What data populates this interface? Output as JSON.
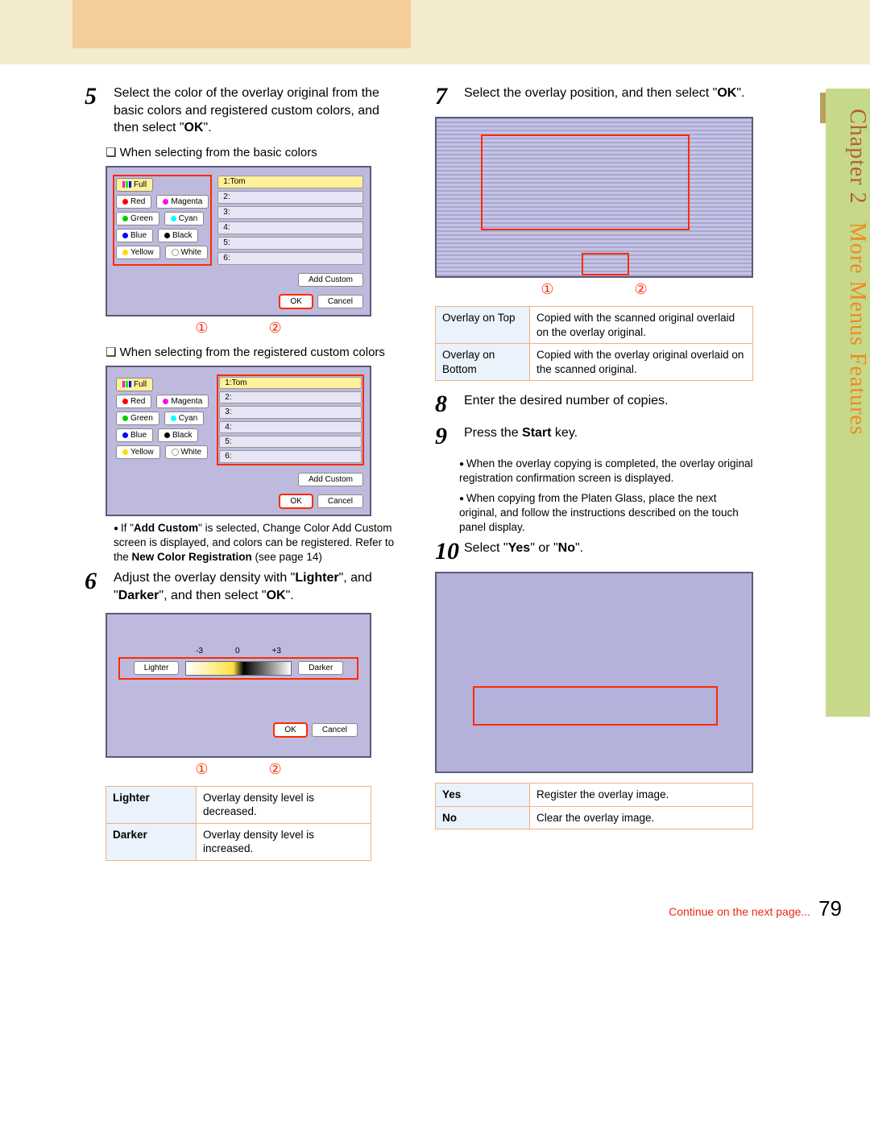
{
  "sidebar": {
    "chapter": "Chapter 2",
    "title": "More Menus Features"
  },
  "steps": {
    "s5": {
      "num": "5",
      "text": "Select the color of the overlay original from the basic colors and registered custom colors, and then select \"",
      "ok": "OK",
      "text2": "\".",
      "sub1": "When selecting from the basic colors",
      "sub2": "When selecting from the registered custom colors",
      "note1a": "If \"",
      "note1b": "Add Custom",
      "note1c": "\" is selected, Change Color Add Custom screen is displayed, and colors can be registered. Refer to the ",
      "note1d": "New Color Registration",
      "note1e": " (see page 14)"
    },
    "s6": {
      "num": "6",
      "text1": "Adjust the overlay density with \"",
      "b1": "Lighter",
      "text2": "\", and \"",
      "b2": "Darker",
      "text3": "\", and then select \"",
      "b3": "OK",
      "text4": "\"."
    },
    "s7": {
      "num": "7",
      "text1": "Select the overlay position, and then select \"",
      "b1": "OK",
      "text2": "\"."
    },
    "s8": {
      "num": "8",
      "text": "Enter the desired number of copies."
    },
    "s9": {
      "num": "9",
      "text1": "Press the ",
      "b1": "Start",
      "text2": " key.",
      "bullet1": "When the overlay copying is completed, the overlay original registration confirmation screen is displayed.",
      "bullet2": "When copying from the Platen Glass, place the next original, and follow the instructions described on the touch panel display."
    },
    "s10": {
      "num": "10",
      "text1": "Select \"",
      "b1": "Yes",
      "text2": "\" or \"",
      "b2": "No",
      "text3": "\"."
    }
  },
  "panel": {
    "full": "Full",
    "red": "Red",
    "magenta": "Magenta",
    "green": "Green",
    "cyan": "Cyan",
    "blue": "Blue",
    "black": "Black",
    "yellow": "Yellow",
    "white": "White",
    "slot1": "1:Tom",
    "slot2": "2:",
    "slot3": "3:",
    "slot4": "4:",
    "slot5": "5:",
    "slot6": "6:",
    "add_custom": "Add Custom",
    "ok": "OK",
    "cancel": "Cancel"
  },
  "density": {
    "m3": "-3",
    "zero": "0",
    "p3": "+3",
    "lighter": "Lighter",
    "darker": "Darker",
    "ok": "OK",
    "cancel": "Cancel"
  },
  "callouts": {
    "c1": "①",
    "c2": "②"
  },
  "table_density": {
    "r1k": "Lighter",
    "r1v": "Overlay density level is decreased.",
    "r2k": "Darker",
    "r2v": "Overlay density level is increased."
  },
  "table_overlay": {
    "r1k": "Overlay on Top",
    "r1v": "Copied with the scanned original overlaid on the overlay original.",
    "r2k": "Overlay on Bottom",
    "r2v": "Copied with the overlay original overlaid on the scanned original."
  },
  "table_yesno": {
    "r1k": "Yes",
    "r1v": "Register the overlay image.",
    "r2k": "No",
    "r2v": "Clear the overlay image."
  },
  "footer": {
    "cont": "Continue on the next page...",
    "page": "79"
  }
}
